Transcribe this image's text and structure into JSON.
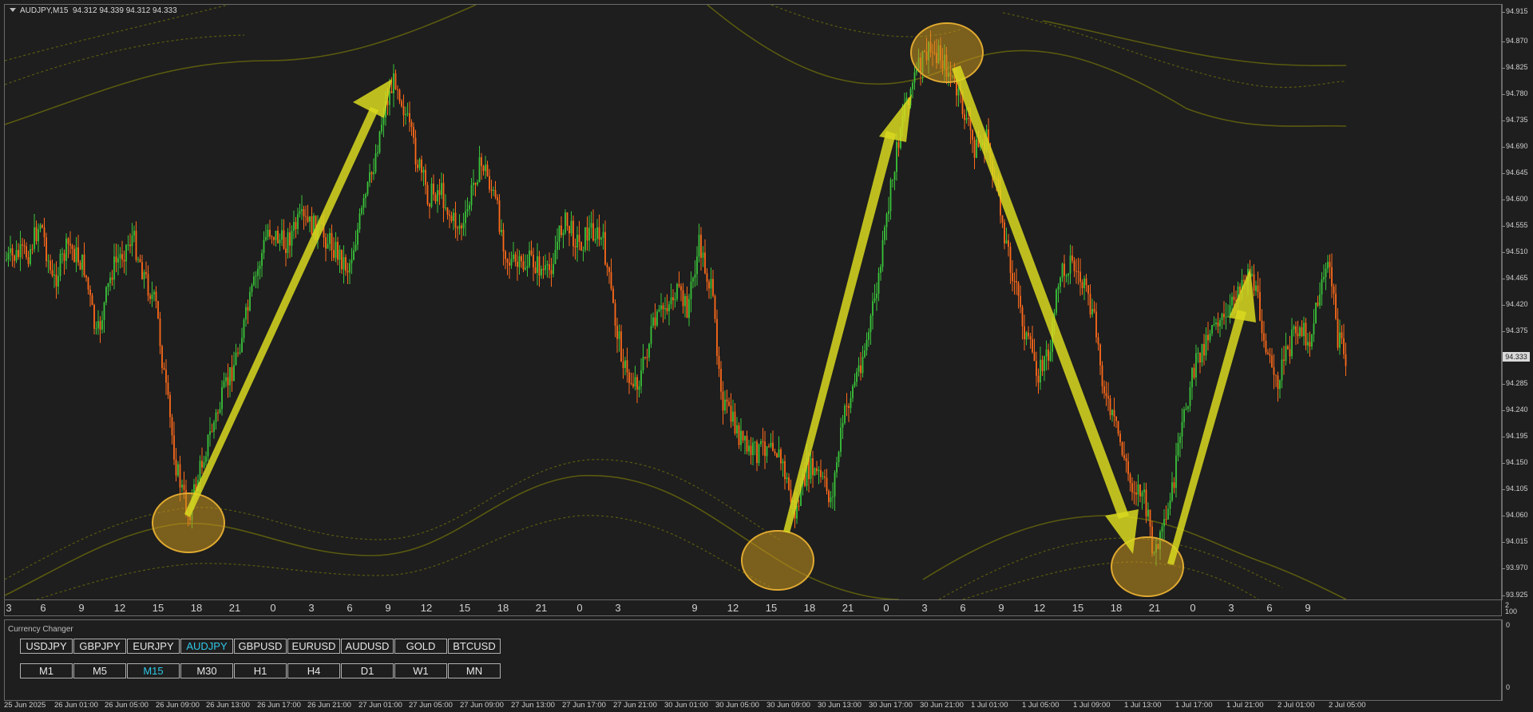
{
  "window": {
    "title": "AUDJPY,M15",
    "ohlc": "94.312 94.339 94.312 94.333"
  },
  "price_axis": {
    "labels": [
      "94.915",
      "94.870",
      "94.825",
      "94.780",
      "94.735",
      "94.690",
      "94.645",
      "94.600",
      "94.555",
      "94.510",
      "94.465",
      "94.420",
      "94.375",
      "94.285",
      "94.240",
      "94.195",
      "94.150",
      "94.105",
      "94.060",
      "94.015",
      "93.970",
      "93.925"
    ],
    "current_price": "94.333"
  },
  "hour_axis": {
    "labels": [
      "3",
      "6",
      "9",
      "12",
      "15",
      "18",
      "21",
      "0",
      "3",
      "6",
      "9",
      "12",
      "15",
      "18",
      "21",
      "0",
      "3",
      "9",
      "12",
      "15",
      "18",
      "21",
      "0",
      "3",
      "6",
      "9",
      "12",
      "15",
      "18",
      "21",
      "0",
      "3",
      "6",
      "9"
    ],
    "scale_top": "2",
    "scale_bottom": "100"
  },
  "indicator": {
    "label": "Currency Changer",
    "scale_top": "0",
    "scale_bottom": "0",
    "symbols": [
      {
        "label": "USDJPY",
        "active": false
      },
      {
        "label": "GBPJPY",
        "active": false
      },
      {
        "label": "EURJPY",
        "active": false
      },
      {
        "label": "AUDJPY",
        "active": true
      },
      {
        "label": "GBPUSD",
        "active": false
      },
      {
        "label": "EURUSD",
        "active": false
      },
      {
        "label": "AUDUSD",
        "active": false
      },
      {
        "label": "GOLD",
        "active": false
      },
      {
        "label": "BTCUSD",
        "active": false
      }
    ],
    "timeframes": [
      {
        "label": "M1",
        "active": false
      },
      {
        "label": "M5",
        "active": false
      },
      {
        "label": "M15",
        "active": true
      },
      {
        "label": "M30",
        "active": false
      },
      {
        "label": "H1",
        "active": false
      },
      {
        "label": "H4",
        "active": false
      },
      {
        "label": "D1",
        "active": false
      },
      {
        "label": "W1",
        "active": false
      },
      {
        "label": "MN",
        "active": false
      }
    ]
  },
  "date_axis": {
    "labels": [
      "25 Jun 2025",
      "26 Jun 01:00",
      "26 Jun 05:00",
      "26 Jun 09:00",
      "26 Jun 13:00",
      "26 Jun 17:00",
      "26 Jun 21:00",
      "27 Jun 01:00",
      "27 Jun 05:00",
      "27 Jun 09:00",
      "27 Jun 13:00",
      "27 Jun 17:00",
      "27 Jun 21:00",
      "30 Jun 01:00",
      "30 Jun 05:00",
      "30 Jun 09:00",
      "30 Jun 13:00",
      "30 Jun 17:00",
      "30 Jun 21:00",
      "1 Jul 01:00",
      "1 Jul 05:00",
      "1 Jul 09:00",
      "1 Jul 13:00",
      "1 Jul 17:00",
      "1 Jul 21:00",
      "2 Jul 01:00",
      "2 Jul 05:00"
    ]
  },
  "colors": {
    "background": "#1e1e1e",
    "bull_candle": "#3ac43a",
    "bear_candle": "#ff6a1a",
    "band": "#5a5a10",
    "arrow": "#d9d920",
    "circle": "#c8961e",
    "active_button": "#2ec8e8"
  }
}
